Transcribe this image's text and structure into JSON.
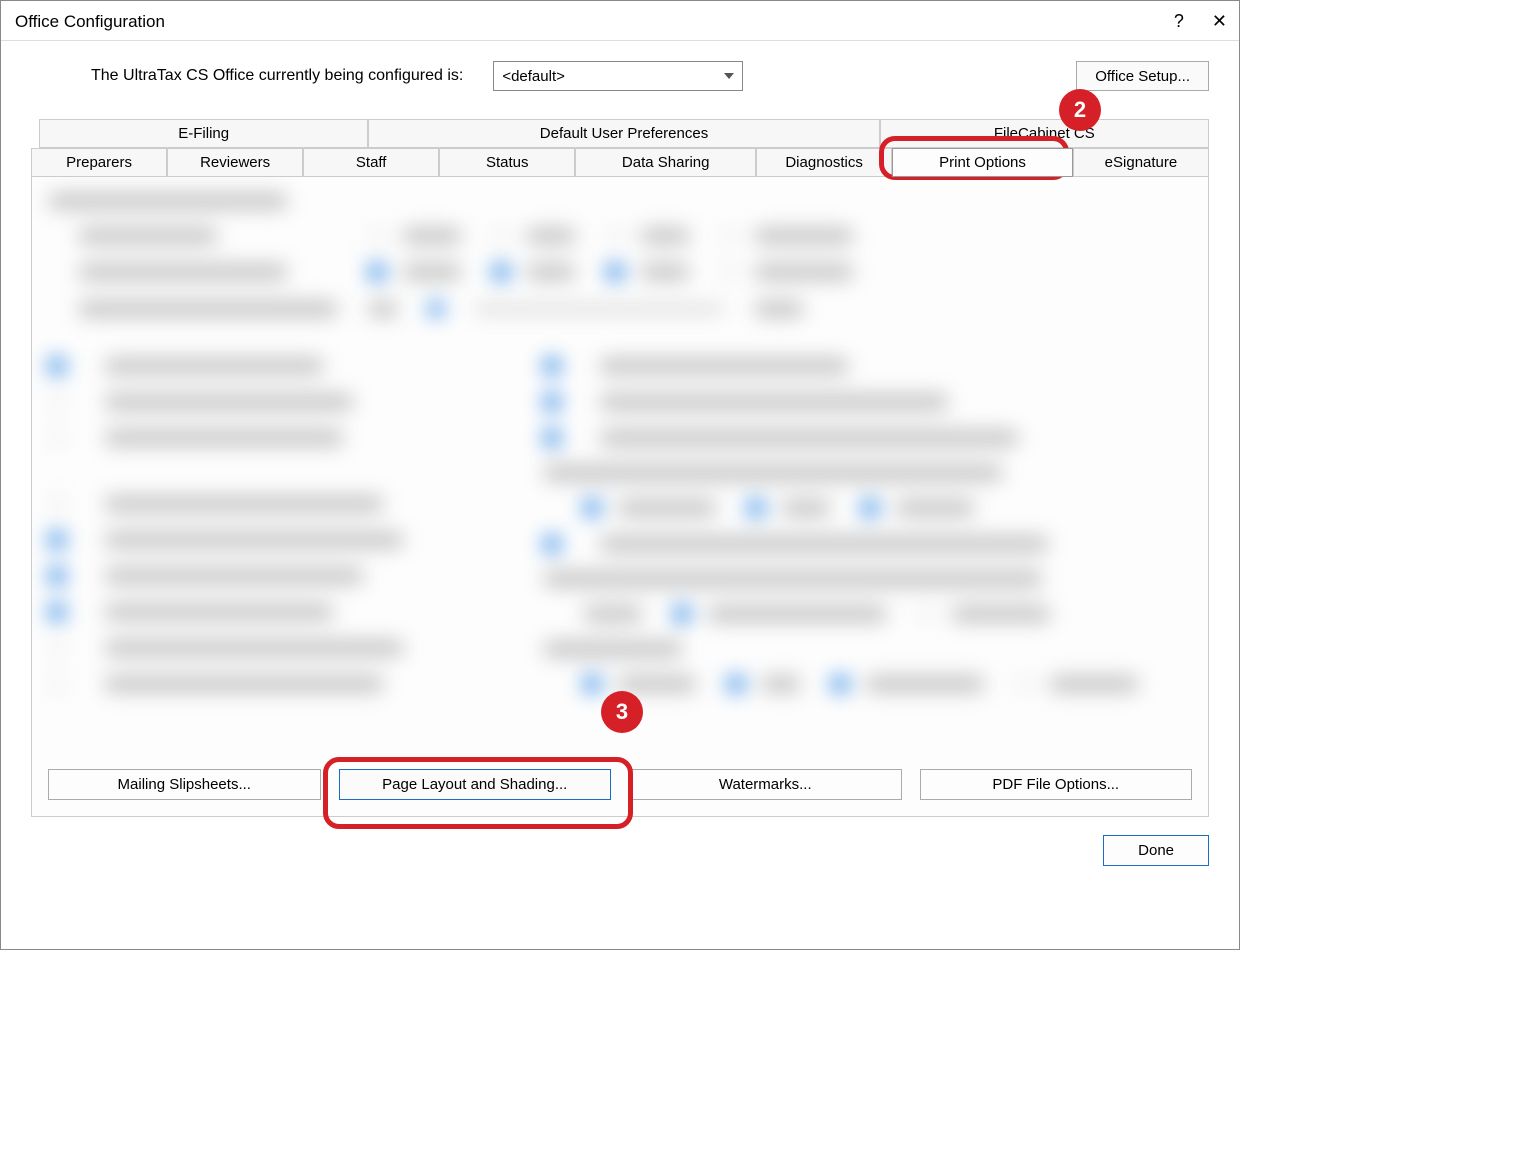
{
  "window": {
    "title": "Office Configuration"
  },
  "header": {
    "label": "The UltraTax CS Office currently being configured is:",
    "selected_office": "<default>",
    "office_setup_btn": "Office Setup..."
  },
  "tabs_row1": [
    "E-Filing",
    "Default User Preferences",
    "FileCabinet CS"
  ],
  "tabs_row2": [
    "Preparers",
    "Reviewers",
    "Staff",
    "Status",
    "Data Sharing",
    "Diagnostics",
    "Print Options",
    "eSignature"
  ],
  "active_tab": "Print Options",
  "buttons": {
    "mailing": "Mailing Slipsheets...",
    "page_layout": "Page Layout and Shading...",
    "watermarks": "Watermarks...",
    "pdf": "PDF File Options..."
  },
  "footer": {
    "done": "Done"
  },
  "callouts": {
    "step2": "2",
    "step3": "3"
  }
}
